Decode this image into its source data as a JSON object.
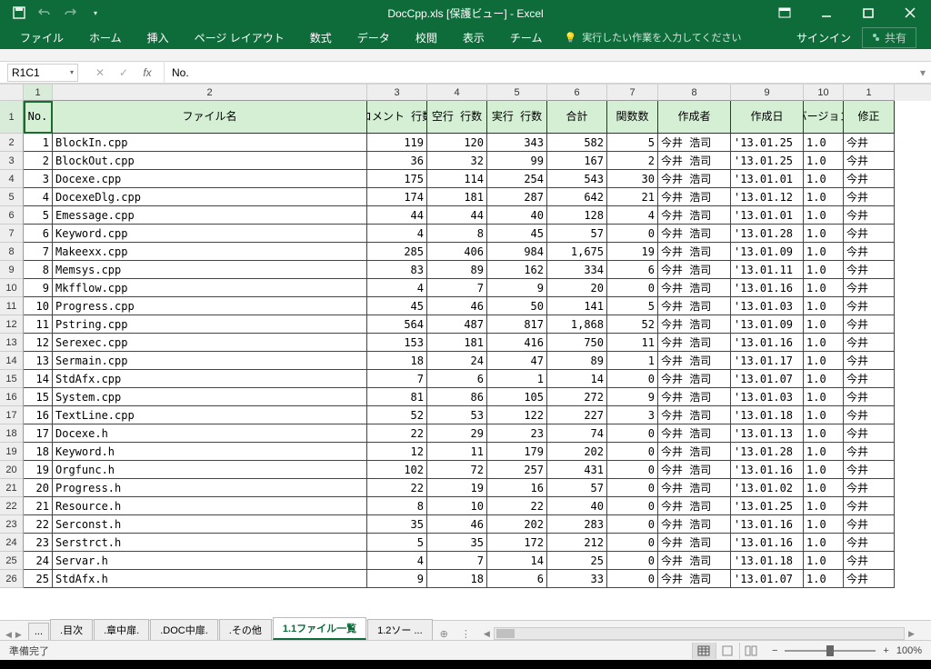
{
  "title": "DocCpp.xls  [保護ビュー] - Excel",
  "ribbon": {
    "tabs": [
      "ファイル",
      "ホーム",
      "挿入",
      "ページ レイアウト",
      "数式",
      "データ",
      "校閲",
      "表示",
      "チーム"
    ],
    "tellme": "実行したい作業を入力してください",
    "signin": "サインイン",
    "share": "共有"
  },
  "namebox": "R1C1",
  "formula": "No.",
  "col_nums": [
    "1",
    "2",
    "3",
    "4",
    "5",
    "6",
    "7",
    "8",
    "9",
    "10",
    "1"
  ],
  "headers": {
    "no": "No.",
    "fname": "ファイル名",
    "comment": "コメント\n行数",
    "blank": "空行\n行数",
    "exec": "実行\n行数",
    "total": "合計",
    "fns": "関数数",
    "author": "作成者",
    "cdate": "作成日",
    "ver": "バージョン",
    "mod": "修正"
  },
  "rows": [
    {
      "n": "1",
      "f": "BlockIn.cpp",
      "cm": "119",
      "bl": "120",
      "ex": "343",
      "tot": "582",
      "fn": "5",
      "au": "今井 浩司",
      "dt": "'13.01.25",
      "v": "1.0",
      "mod": "今井"
    },
    {
      "n": "2",
      "f": "BlockOut.cpp",
      "cm": "36",
      "bl": "32",
      "ex": "99",
      "tot": "167",
      "fn": "2",
      "au": "今井 浩司",
      "dt": "'13.01.25",
      "v": "1.0",
      "mod": "今井"
    },
    {
      "n": "3",
      "f": "Docexe.cpp",
      "cm": "175",
      "bl": "114",
      "ex": "254",
      "tot": "543",
      "fn": "30",
      "au": "今井 浩司",
      "dt": "'13.01.01",
      "v": "1.0",
      "mod": "今井"
    },
    {
      "n": "4",
      "f": "DocexeDlg.cpp",
      "cm": "174",
      "bl": "181",
      "ex": "287",
      "tot": "642",
      "fn": "21",
      "au": "今井 浩司",
      "dt": "'13.01.12",
      "v": "1.0",
      "mod": "今井"
    },
    {
      "n": "5",
      "f": "Emessage.cpp",
      "cm": "44",
      "bl": "44",
      "ex": "40",
      "tot": "128",
      "fn": "4",
      "au": "今井 浩司",
      "dt": "'13.01.01",
      "v": "1.0",
      "mod": "今井"
    },
    {
      "n": "6",
      "f": "Keyword.cpp",
      "cm": "4",
      "bl": "8",
      "ex": "45",
      "tot": "57",
      "fn": "0",
      "au": "今井 浩司",
      "dt": "'13.01.28",
      "v": "1.0",
      "mod": "今井"
    },
    {
      "n": "7",
      "f": "Makeexx.cpp",
      "cm": "285",
      "bl": "406",
      "ex": "984",
      "tot": "1,675",
      "fn": "19",
      "au": "今井 浩司",
      "dt": "'13.01.09",
      "v": "1.0",
      "mod": "今井"
    },
    {
      "n": "8",
      "f": "Memsys.cpp",
      "cm": "83",
      "bl": "89",
      "ex": "162",
      "tot": "334",
      "fn": "6",
      "au": "今井 浩司",
      "dt": "'13.01.11",
      "v": "1.0",
      "mod": "今井"
    },
    {
      "n": "9",
      "f": "Mkfflow.cpp",
      "cm": "4",
      "bl": "7",
      "ex": "9",
      "tot": "20",
      "fn": "0",
      "au": "今井 浩司",
      "dt": "'13.01.16",
      "v": "1.0",
      "mod": "今井"
    },
    {
      "n": "10",
      "f": "Progress.cpp",
      "cm": "45",
      "bl": "46",
      "ex": "50",
      "tot": "141",
      "fn": "5",
      "au": "今井 浩司",
      "dt": "'13.01.03",
      "v": "1.0",
      "mod": "今井"
    },
    {
      "n": "11",
      "f": "Pstring.cpp",
      "cm": "564",
      "bl": "487",
      "ex": "817",
      "tot": "1,868",
      "fn": "52",
      "au": "今井 浩司",
      "dt": "'13.01.09",
      "v": "1.0",
      "mod": "今井"
    },
    {
      "n": "12",
      "f": "Serexec.cpp",
      "cm": "153",
      "bl": "181",
      "ex": "416",
      "tot": "750",
      "fn": "11",
      "au": "今井 浩司",
      "dt": "'13.01.16",
      "v": "1.0",
      "mod": "今井"
    },
    {
      "n": "13",
      "f": "Sermain.cpp",
      "cm": "18",
      "bl": "24",
      "ex": "47",
      "tot": "89",
      "fn": "1",
      "au": "今井 浩司",
      "dt": "'13.01.17",
      "v": "1.0",
      "mod": "今井"
    },
    {
      "n": "14",
      "f": "StdAfx.cpp",
      "cm": "7",
      "bl": "6",
      "ex": "1",
      "tot": "14",
      "fn": "0",
      "au": "今井 浩司",
      "dt": "'13.01.07",
      "v": "1.0",
      "mod": "今井"
    },
    {
      "n": "15",
      "f": "System.cpp",
      "cm": "81",
      "bl": "86",
      "ex": "105",
      "tot": "272",
      "fn": "9",
      "au": "今井 浩司",
      "dt": "'13.01.03",
      "v": "1.0",
      "mod": "今井"
    },
    {
      "n": "16",
      "f": "TextLine.cpp",
      "cm": "52",
      "bl": "53",
      "ex": "122",
      "tot": "227",
      "fn": "3",
      "au": "今井 浩司",
      "dt": "'13.01.18",
      "v": "1.0",
      "mod": "今井"
    },
    {
      "n": "17",
      "f": "Docexe.h",
      "cm": "22",
      "bl": "29",
      "ex": "23",
      "tot": "74",
      "fn": "0",
      "au": "今井 浩司",
      "dt": "'13.01.13",
      "v": "1.0",
      "mod": "今井"
    },
    {
      "n": "18",
      "f": "Keyword.h",
      "cm": "12",
      "bl": "11",
      "ex": "179",
      "tot": "202",
      "fn": "0",
      "au": "今井 浩司",
      "dt": "'13.01.28",
      "v": "1.0",
      "mod": "今井"
    },
    {
      "n": "19",
      "f": "Orgfunc.h",
      "cm": "102",
      "bl": "72",
      "ex": "257",
      "tot": "431",
      "fn": "0",
      "au": "今井 浩司",
      "dt": "'13.01.16",
      "v": "1.0",
      "mod": "今井"
    },
    {
      "n": "20",
      "f": "Progress.h",
      "cm": "22",
      "bl": "19",
      "ex": "16",
      "tot": "57",
      "fn": "0",
      "au": "今井 浩司",
      "dt": "'13.01.02",
      "v": "1.0",
      "mod": "今井"
    },
    {
      "n": "21",
      "f": "Resource.h",
      "cm": "8",
      "bl": "10",
      "ex": "22",
      "tot": "40",
      "fn": "0",
      "au": "今井 浩司",
      "dt": "'13.01.25",
      "v": "1.0",
      "mod": "今井"
    },
    {
      "n": "22",
      "f": "Serconst.h",
      "cm": "35",
      "bl": "46",
      "ex": "202",
      "tot": "283",
      "fn": "0",
      "au": "今井 浩司",
      "dt": "'13.01.16",
      "v": "1.0",
      "mod": "今井"
    },
    {
      "n": "23",
      "f": "Serstrct.h",
      "cm": "5",
      "bl": "35",
      "ex": "172",
      "tot": "212",
      "fn": "0",
      "au": "今井 浩司",
      "dt": "'13.01.16",
      "v": "1.0",
      "mod": "今井"
    },
    {
      "n": "24",
      "f": "Servar.h",
      "cm": "4",
      "bl": "7",
      "ex": "14",
      "tot": "25",
      "fn": "0",
      "au": "今井 浩司",
      "dt": "'13.01.18",
      "v": "1.0",
      "mod": "今井"
    },
    {
      "n": "25",
      "f": "StdAfx.h",
      "cm": "9",
      "bl": "18",
      "ex": "6",
      "tot": "33",
      "fn": "0",
      "au": "今井 浩司",
      "dt": "'13.01.07",
      "v": "1.0",
      "mod": "今井"
    }
  ],
  "sheet_tabs": {
    "hidden": "...",
    "items": [
      ".目次",
      ".章中扉.",
      ".DOC中扉.",
      ".その他",
      "1.1ファイル一覧",
      "1.2ソー ..."
    ],
    "active_index": 4,
    "add": "⊕"
  },
  "status": {
    "ready": "準備完了",
    "zoom": "100%"
  }
}
